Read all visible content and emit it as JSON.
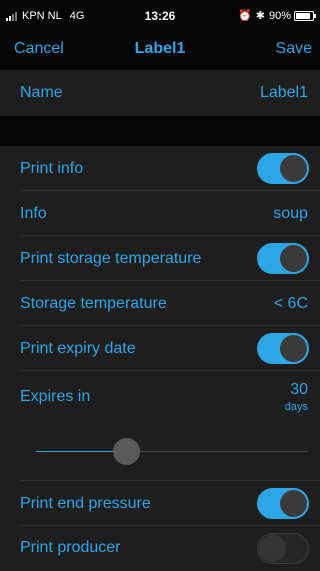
{
  "status_bar": {
    "carrier": "KPN NL",
    "network": "4G",
    "time": "13:26",
    "battery_percent": "90%",
    "battery_level": 0.9,
    "icons": [
      "signal-icon",
      "alarm-icon",
      "bluetooth-icon",
      "battery-icon"
    ]
  },
  "nav": {
    "cancel_label": "Cancel",
    "title": "Label1",
    "save_label": "Save"
  },
  "form": {
    "name": {
      "label": "Name",
      "value": "Label1"
    },
    "print_info": {
      "label": "Print info",
      "on": true
    },
    "info": {
      "label": "Info",
      "value": "soup"
    },
    "print_storage_temperature": {
      "label": "Print storage temperature",
      "on": true
    },
    "storage_temperature": {
      "label": "Storage temperature",
      "value": "< 6C"
    },
    "print_expiry_date": {
      "label": "Print expiry date",
      "on": true
    },
    "expires_in": {
      "label": "Expires in",
      "value": "30",
      "unit": "days",
      "slider_fraction": 0.37
    },
    "print_end_pressure": {
      "label": "Print end pressure",
      "on": true
    },
    "print_producer": {
      "label": "Print producer",
      "on": false
    }
  },
  "colors": {
    "accent": "#2ea6e6",
    "background": "#1e1e1f",
    "bar": "#050505"
  }
}
